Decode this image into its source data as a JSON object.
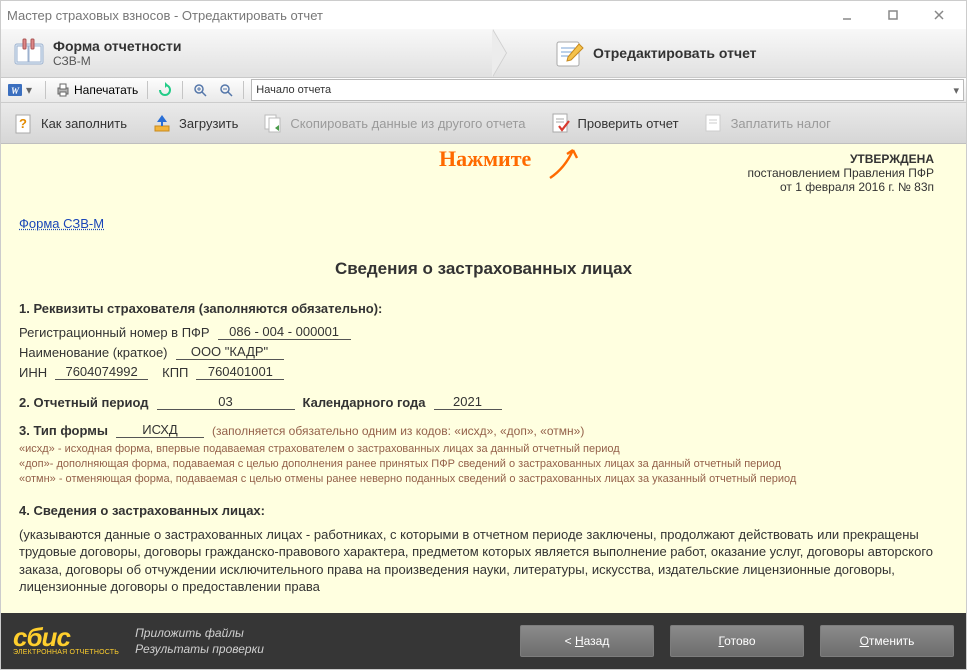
{
  "window": {
    "title": "Мастер страховых взносов - Отредактировать отчет"
  },
  "crumbs": {
    "step1": {
      "title": "Форма отчетности",
      "subtitle": "СЗВ-М"
    },
    "step2": {
      "title": "Отредактировать отчет"
    }
  },
  "smalltoolbar": {
    "print": "Напечатать",
    "sectionSelector": "Начало отчета"
  },
  "actions": {
    "howToFill": "Как заполнить",
    "load": "Загрузить",
    "copyFrom": "Скопировать данные из другого отчета",
    "check": "Проверить отчет",
    "payTax": "Заплатить налог"
  },
  "annotation": {
    "text": "Нажмите"
  },
  "approved": {
    "line1": "УТВЕРЖДЕНА",
    "line2": "постановлением Правления ПФР",
    "line3": "от 1 февраля 2016 г. № 83п"
  },
  "formLink": "Форма СЗВ-М",
  "docTitle": "Сведения о застрахованных лицах",
  "section1": {
    "heading": "1. Реквизиты страхователя (заполняются обязательно):",
    "regLabel": "Регистрационный номер в ПФР",
    "regValue": "086 - 004 - 000001",
    "nameLabel": "Наименование (краткое)",
    "nameValue": "ООО \"КАДР\"",
    "innLabel": "ИНН",
    "innValue": "7604074992",
    "kppLabel": "КПП",
    "kppValue": "760401001"
  },
  "section2": {
    "heading": "2. Отчетный период",
    "monthValue": "03",
    "yearLabel": "Календарного года",
    "yearValue": "2021"
  },
  "section3": {
    "heading": "3. Тип формы",
    "typeValue": "ИСХД",
    "typeHint": "(заполняется обязательно одним из кодов: «исхд», «доп», «отмн»)",
    "note1": "«исхд» - исходная форма, впервые подаваемая страхователем о застрахованных лицах за данный отчетный период",
    "note2": "«доп»- дополняющая форма, подаваемая с целью дополнения ранее принятых ПФР сведений о застрахованных лицах за данный отчетный период",
    "note3": "«отмн» - отменяющая форма, подаваемая с целью отмены ранее неверно поданных сведений о застрахованных лицах за указанный отчетный период"
  },
  "section4": {
    "heading": "4. Сведения о застрахованных лицах:",
    "para": "(указываются данные о застрахованных лицах - работниках, с которыми в отчетном периоде заключены, продолжают действовать или прекращены трудовые договоры, договоры гражданско-правового характера, предметом которых является выполнение работ, оказание услуг, договоры авторского заказа, договоры об отчуждении исключительного права на произведения науки, литературы, искусства, издательские лицензионные договоры, лицензионные договоры о предоставлении права"
  },
  "footer": {
    "logo": "сбис",
    "logoSub": "ЭЛЕКТРОННАЯ ОТЧЕТНОСТЬ",
    "attach": "Приложить файлы",
    "results": "Результаты проверки",
    "back": "< Назад",
    "finish": "Готово",
    "cancel": "Отменить"
  }
}
